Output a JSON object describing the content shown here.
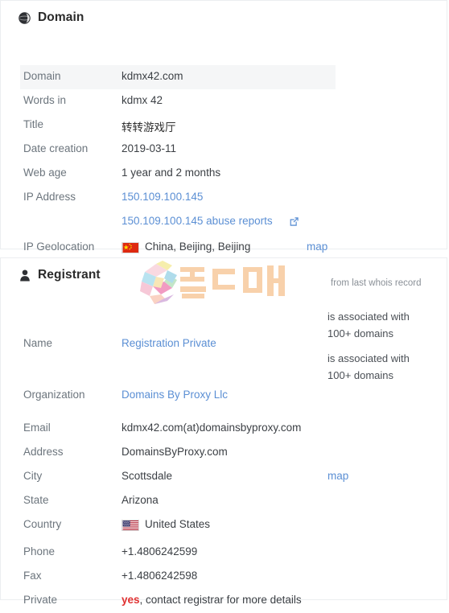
{
  "colors": {
    "link": "#5b8fd4",
    "label": "#6c757d",
    "value": "#3b3f44",
    "shade": "#f5f6f7",
    "border": "#ebeef0",
    "alert_red": "#e03131"
  },
  "domain_card": {
    "icon": "globe-icon",
    "title": "Domain",
    "rows": [
      {
        "label": "Domain",
        "value": "kdmx42.com",
        "highlight": true
      },
      {
        "label": "Words in",
        "value": "kdmx 42"
      },
      {
        "label": "Title",
        "value": "转转游戏厅",
        "cjk": true
      },
      {
        "label": "Date creation",
        "value": "2019-03-11"
      },
      {
        "label": "Web age",
        "value": "1 year and 2 months"
      },
      {
        "label": "IP Address",
        "value": "150.109.100.145",
        "link": true
      },
      {
        "label": "",
        "value": "150.109.100.145 abuse reports",
        "link": true,
        "external_icon": "external-link-icon"
      },
      {
        "label": "IP Geolocation",
        "value": "China, Beijing, Beijing",
        "flag": "cn-flag-icon",
        "map_link": "map"
      }
    ]
  },
  "registrant_card": {
    "icon": "user-icon",
    "title": "Registrant",
    "source_note": "from last whois record",
    "watermark": "shieldman-logo",
    "rows": [
      {
        "label": "Name",
        "value": "Registration Private",
        "link": true,
        "note": "is associated with 100+ domains"
      },
      {
        "label": "Organization",
        "value": "Domains By Proxy Llc",
        "link": true,
        "note": "is associated with 100+ domains"
      },
      {
        "label": "Email",
        "value": "kdmx42.com(at)domainsbyproxy.com"
      },
      {
        "label": "Address",
        "value": "DomainsByProxy.com"
      },
      {
        "label": "City",
        "value": "Scottsdale",
        "map_link": "map"
      },
      {
        "label": "State",
        "value": "Arizona"
      },
      {
        "label": "Country",
        "value": "United States",
        "flag": "us-flag-icon"
      },
      {
        "label": "Phone",
        "value": "+1.4806242599"
      },
      {
        "label": "Fax",
        "value": "+1.4806242598"
      },
      {
        "label": "Private",
        "value_emphasis": "yes",
        "value_rest": ", contact registrar for more details"
      }
    ],
    "assoc_notes": [
      {
        "line1": "is associated with",
        "line2": "100+ domains"
      },
      {
        "line1": "is associated with",
        "line2": "100+ domains"
      }
    ]
  }
}
